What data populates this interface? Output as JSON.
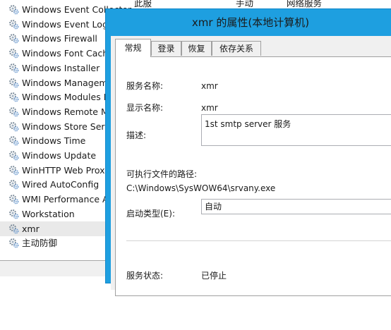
{
  "services": {
    "header_desc": "此服",
    "header_status": "手动",
    "header_logon": "网络服务",
    "items": [
      {
        "name": "Windows Event Collector",
        "selected": false
      },
      {
        "name": "Windows Event Log",
        "selected": false
      },
      {
        "name": "Windows Firewall",
        "selected": false
      },
      {
        "name": "Windows Font Cache",
        "selected": false
      },
      {
        "name": "Windows Installer",
        "selected": false
      },
      {
        "name": "Windows Manageme",
        "selected": false
      },
      {
        "name": "Windows Modules In",
        "selected": false
      },
      {
        "name": "Windows Remote Ma",
        "selected": false
      },
      {
        "name": "Windows Store Servi",
        "selected": false
      },
      {
        "name": "Windows Time",
        "selected": false
      },
      {
        "name": "Windows Update",
        "selected": false
      },
      {
        "name": "WinHTTP Web Proxy",
        "selected": false
      },
      {
        "name": "Wired AutoConfig",
        "selected": false
      },
      {
        "name": "WMI Performance Ac",
        "selected": false
      },
      {
        "name": "Workstation",
        "selected": false
      },
      {
        "name": "xmr",
        "selected": true
      },
      {
        "name": "主动防御",
        "selected": false
      }
    ],
    "icon": "gear-icon"
  },
  "dialog": {
    "title": "xmr 的属性(本地计算机)",
    "tabs": [
      "常规",
      "登录",
      "恢复",
      "依存关系"
    ],
    "active_tab": 0,
    "service_name_label": "服务名称:",
    "service_name": "xmr",
    "display_name_label": "显示名称:",
    "display_name": "xmr",
    "description_label": "描述:",
    "description": "1st smtp server 服务",
    "path_label": "可执行文件的路径:",
    "path": "C:\\Windows\\SysWOW64\\srvany.exe",
    "startup_type_label": "启动类型(E):",
    "startup_type": "自动",
    "status_label": "服务状态:",
    "status": "已停止"
  },
  "colors": {
    "dialog_border": "#1e9fe0",
    "selected_row": "#e9e9e9"
  }
}
